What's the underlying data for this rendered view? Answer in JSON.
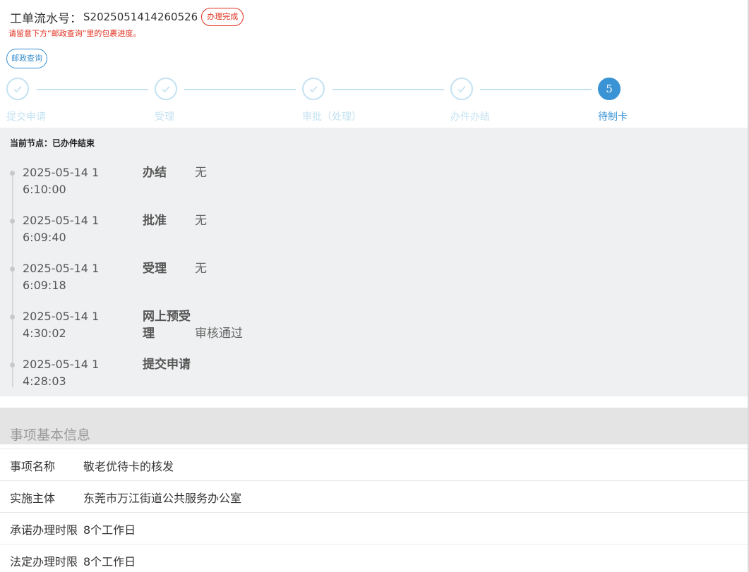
{
  "header": {
    "order_label": "工单流水号：",
    "order_no": "S2025051414260526",
    "status": "办理完成",
    "notice": "请留意下方“邮政查询”里的包裹进度。",
    "postal_button": "邮政查询"
  },
  "steps": [
    {
      "label": "提交申请",
      "state": "done"
    },
    {
      "label": "受理",
      "state": "done"
    },
    {
      "label": "审批（处理）",
      "state": "done"
    },
    {
      "label": "办件办结",
      "state": "done"
    },
    {
      "label": "待制卡",
      "state": "active",
      "number": "5"
    }
  ],
  "timeline": {
    "current_node": "当前节点：已办件结束",
    "items": [
      {
        "time": "2025-05-14 16:10:00",
        "action": "办结",
        "remark": "无"
      },
      {
        "time": "2025-05-14 16:09:40",
        "action": "批准",
        "remark": "无"
      },
      {
        "time": "2025-05-14 16:09:18",
        "action": "受理",
        "remark": "无"
      },
      {
        "time": "2025-05-14 14:30:02",
        "action": "网上预受理",
        "remark": "审核通过"
      },
      {
        "time": "2025-05-14 14:28:03",
        "action": "提交申请",
        "remark": ""
      }
    ]
  },
  "basic_info": {
    "title": "事项基本信息",
    "rows": [
      {
        "label": "事项名称",
        "value": "敬老优待卡的核发"
      },
      {
        "label": "实施主体",
        "value": "东莞市万江街道公共服务办公室"
      },
      {
        "label": "承诺办理时限",
        "value": "8个工作日"
      },
      {
        "label": "法定办理时限",
        "value": "8个工作日"
      }
    ]
  },
  "colors": {
    "accent": "#3a93d4",
    "status_red": "#e0301e",
    "step_done": "#c4e2f2",
    "panel_bg": "#eff0f1"
  },
  "icons": {
    "step_done": "check-icon",
    "timeline_marker": "dot-icon"
  }
}
